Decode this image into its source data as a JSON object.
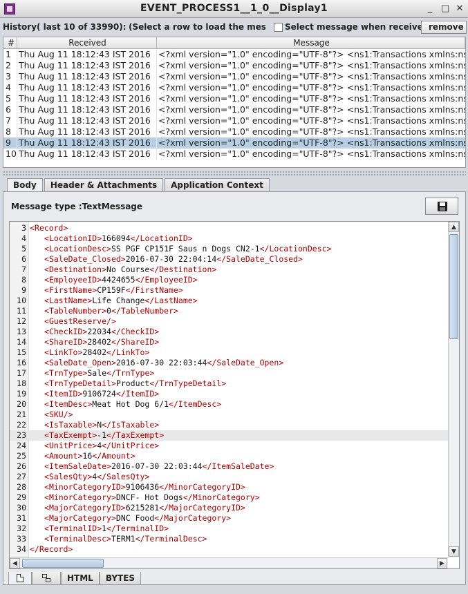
{
  "window": {
    "title": "EVENT_PROCESS1__1_0__Display1"
  },
  "history": {
    "label": "History( last 10 of 33990):",
    "hint": "(Select a row to load the mess...",
    "checkbox_label": "Select message when received",
    "remove_label": "remove ..."
  },
  "history_table": {
    "columns": [
      "#",
      "Received",
      "Message"
    ],
    "rows": [
      {
        "n": "1",
        "received": "Thu Aug 11 18:12:43 IST 2016",
        "message": "<?xml version=\"1.0\" encoding=\"UTF-8\"?> <ns1:Transactions xmlns:ns1=\"..."
      },
      {
        "n": "2",
        "received": "Thu Aug 11 18:12:43 IST 2016",
        "message": "<?xml version=\"1.0\" encoding=\"UTF-8\"?> <ns1:Transactions xmlns:ns1=\"..."
      },
      {
        "n": "3",
        "received": "Thu Aug 11 18:12:43 IST 2016",
        "message": "<?xml version=\"1.0\" encoding=\"UTF-8\"?> <ns1:Transactions xmlns:ns1=\"..."
      },
      {
        "n": "4",
        "received": "Thu Aug 11 18:12:43 IST 2016",
        "message": "<?xml version=\"1.0\" encoding=\"UTF-8\"?> <ns1:Transactions xmlns:ns1=\"..."
      },
      {
        "n": "5",
        "received": "Thu Aug 11 18:12:43 IST 2016",
        "message": "<?xml version=\"1.0\" encoding=\"UTF-8\"?> <ns1:Transactions xmlns:ns1=\"..."
      },
      {
        "n": "6",
        "received": "Thu Aug 11 18:12:43 IST 2016",
        "message": "<?xml version=\"1.0\" encoding=\"UTF-8\"?> <ns1:Transactions xmlns:ns1=\"..."
      },
      {
        "n": "7",
        "received": "Thu Aug 11 18:12:43 IST 2016",
        "message": "<?xml version=\"1.0\" encoding=\"UTF-8\"?> <ns1:Transactions xmlns:ns1=\"..."
      },
      {
        "n": "8",
        "received": "Thu Aug 11 18:12:43 IST 2016",
        "message": "<?xml version=\"1.0\" encoding=\"UTF-8\"?> <ns1:Transactions xmlns:ns1=\"..."
      },
      {
        "n": "9",
        "received": "Thu Aug 11 18:12:43 IST 2016",
        "message": "<?xml version=\"1.0\" encoding=\"UTF-8\"?> <ns1:Transactions xmlns:ns1=\"...",
        "selected": true
      },
      {
        "n": "10",
        "received": "Thu Aug 11 18:12:43 IST 2016",
        "message": "<?xml version=\"1.0\" encoding=\"UTF-8\"?> <ns1:Transactions xmlns:ns1=\"..."
      }
    ]
  },
  "tabs": {
    "items": [
      "Body",
      "Header & Attachments",
      "Application Context"
    ],
    "active": "Body"
  },
  "body": {
    "message_type": "Message type :TextMessage",
    "save_icon": "floppy-disk-icon"
  },
  "editor": {
    "highlighted_line": "23",
    "lines": [
      {
        "n": "3",
        "indent": 1,
        "tag": "Record",
        "value": null,
        "kind": "open"
      },
      {
        "n": "4",
        "indent": 2,
        "tag": "LocationID",
        "value": "166094",
        "kind": "pair"
      },
      {
        "n": "5",
        "indent": 2,
        "tag": "LocationDesc",
        "value": "SS PGF CP151F Saus n Dogs CN2-1",
        "kind": "pair"
      },
      {
        "n": "6",
        "indent": 2,
        "tag": "SaleDate_Closed",
        "value": "2016-07-30 22:04:14",
        "kind": "pair"
      },
      {
        "n": "7",
        "indent": 2,
        "tag": "Destination",
        "value": "No Course",
        "kind": "pair"
      },
      {
        "n": "8",
        "indent": 2,
        "tag": "EmployeeID",
        "value": "4424655",
        "kind": "pair"
      },
      {
        "n": "9",
        "indent": 2,
        "tag": "FirstName",
        "value": "CP159F",
        "kind": "pair"
      },
      {
        "n": "10",
        "indent": 2,
        "tag": "LastName",
        "value": "Life Change",
        "kind": "pair"
      },
      {
        "n": "11",
        "indent": 2,
        "tag": "TableNumber",
        "value": "0",
        "kind": "pair"
      },
      {
        "n": "12",
        "indent": 2,
        "tag": "GuestReserve",
        "value": null,
        "kind": "empty"
      },
      {
        "n": "13",
        "indent": 2,
        "tag": "CheckID",
        "value": "22034",
        "kind": "pair"
      },
      {
        "n": "14",
        "indent": 2,
        "tag": "ShareID",
        "value": "28402",
        "kind": "pair"
      },
      {
        "n": "15",
        "indent": 2,
        "tag": "LinkTo",
        "value": "28402",
        "kind": "pair"
      },
      {
        "n": "16",
        "indent": 2,
        "tag": "SaleDate_Open",
        "value": "2016-07-30 22:03:44",
        "kind": "pair"
      },
      {
        "n": "17",
        "indent": 2,
        "tag": "TrnType",
        "value": "Sale",
        "kind": "pair"
      },
      {
        "n": "18",
        "indent": 2,
        "tag": "TrnTypeDetail",
        "value": "Product",
        "kind": "pair"
      },
      {
        "n": "19",
        "indent": 2,
        "tag": "ItemID",
        "value": "9106724",
        "kind": "pair"
      },
      {
        "n": "20",
        "indent": 2,
        "tag": "ItemDesc",
        "value": "Meat Hot Dog 6/1",
        "kind": "pair"
      },
      {
        "n": "21",
        "indent": 2,
        "tag": "SKU",
        "value": null,
        "kind": "empty"
      },
      {
        "n": "22",
        "indent": 2,
        "tag": "IsTaxable",
        "value": "N",
        "kind": "pair"
      },
      {
        "n": "23",
        "indent": 2,
        "tag": "TaxExempt",
        "value": "-1",
        "kind": "pair"
      },
      {
        "n": "24",
        "indent": 2,
        "tag": "UnitPrice",
        "value": "4",
        "kind": "pair"
      },
      {
        "n": "25",
        "indent": 2,
        "tag": "Amount",
        "value": "16",
        "kind": "pair"
      },
      {
        "n": "26",
        "indent": 2,
        "tag": "ItemSaleDate",
        "value": "2016-07-30 22:03:44",
        "kind": "pair"
      },
      {
        "n": "27",
        "indent": 2,
        "tag": "SalesQty",
        "value": "4",
        "kind": "pair"
      },
      {
        "n": "28",
        "indent": 2,
        "tag": "MinorCategoryID",
        "value": "9106436",
        "kind": "pair"
      },
      {
        "n": "29",
        "indent": 2,
        "tag": "MinorCategory",
        "value": "DNCF- Hot Dogs",
        "kind": "pair"
      },
      {
        "n": "30",
        "indent": 2,
        "tag": "MajorCategoryID",
        "value": "6215281",
        "kind": "pair"
      },
      {
        "n": "31",
        "indent": 2,
        "tag": "MajorCategory",
        "value": "DNC Food",
        "kind": "pair"
      },
      {
        "n": "32",
        "indent": 2,
        "tag": "TerminalID",
        "value": "1",
        "kind": "pair"
      },
      {
        "n": "33",
        "indent": 2,
        "tag": "TerminalDesc",
        "value": "TERM1",
        "kind": "pair"
      },
      {
        "n": "34",
        "indent": 1,
        "tag": "Record",
        "value": null,
        "kind": "close"
      }
    ]
  },
  "bottom_tabs": {
    "items": [
      "",
      "",
      "HTML",
      "BYTES"
    ],
    "icons": [
      "document-icon",
      "tree-icon"
    ]
  }
}
